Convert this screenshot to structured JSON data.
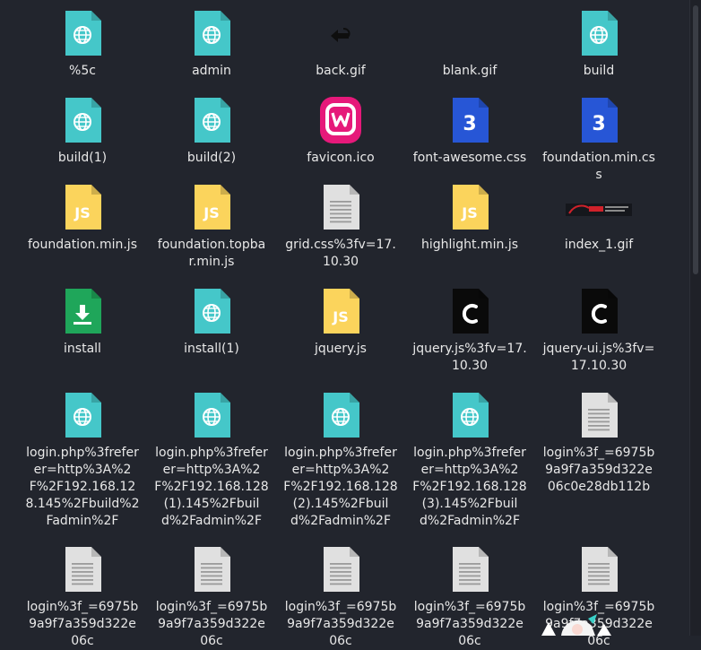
{
  "files": [
    {
      "name": "%5c",
      "icon": "web-icon"
    },
    {
      "name": "admin",
      "icon": "web-icon"
    },
    {
      "name": "back.gif",
      "icon": "back-arrow-icon"
    },
    {
      "name": "blank.gif",
      "icon": "blank-icon"
    },
    {
      "name": "build",
      "icon": "web-icon"
    },
    {
      "name": "build(1)",
      "icon": "web-icon"
    },
    {
      "name": "build(2)",
      "icon": "web-icon"
    },
    {
      "name": "favicon.ico",
      "icon": "wamp-logo-icon"
    },
    {
      "name": "font-awesome.css",
      "icon": "css-icon"
    },
    {
      "name": "foundation.min.css",
      "icon": "css-icon"
    },
    {
      "name": "foundation.min.js",
      "icon": "js-icon"
    },
    {
      "name": "foundation.topbar.min.js",
      "icon": "js-icon"
    },
    {
      "name": "grid.css%3fv=17.10.30",
      "icon": "text-file-icon"
    },
    {
      "name": "highlight.min.js",
      "icon": "js-icon"
    },
    {
      "name": "index_1.gif",
      "icon": "banner-image-icon"
    },
    {
      "name": "install",
      "icon": "installer-icon"
    },
    {
      "name": "install(1)",
      "icon": "web-icon"
    },
    {
      "name": "jquery.js",
      "icon": "js-icon"
    },
    {
      "name": "jquery.js%3fv=17.10.30",
      "icon": "c-file-icon"
    },
    {
      "name": "jquery-ui.js%3fv=17.10.30",
      "icon": "c-file-icon"
    },
    {
      "name": "login.php%3freferer=http%3A%2F%2F192.168.128.145%2Fbuild%2Fadmin%2F",
      "icon": "web-icon"
    },
    {
      "name": "login.php%3freferer=http%3A%2F%2F192.168.128(1).145%2Fbuild%2Fadmin%2F",
      "icon": "web-icon"
    },
    {
      "name": "login.php%3freferer=http%3A%2F%2F192.168.128(2).145%2Fbuild%2Fadmin%2F",
      "icon": "web-icon"
    },
    {
      "name": "login.php%3freferer=http%3A%2F%2F192.168.128(3).145%2Fbuild%2Fadmin%2F",
      "icon": "web-icon"
    },
    {
      "name": "login%3f_=6975b9a9f7a359d322e06c0e28db112b",
      "icon": "text-file-icon"
    },
    {
      "name": "login%3f_=6975b9a9f7a359d322e06c",
      "icon": "text-file-icon"
    },
    {
      "name": "login%3f_=6975b9a9f7a359d322e06c",
      "icon": "text-file-icon"
    },
    {
      "name": "login%3f_=6975b9a9f7a359d322e06c",
      "icon": "text-file-icon"
    },
    {
      "name": "login%3f_=6975b9a9f7a359d322e06c",
      "icon": "text-file-icon"
    },
    {
      "name": "login%3f_=6975b9a9f7a359d322e06c",
      "icon": "text-file-icon"
    }
  ],
  "colors": {
    "web": "#45c7c9",
    "css": "#2756d6",
    "js": "#fbd45c",
    "text": "#e0e0e0",
    "installer": "#1fa65a",
    "c_file": "#0a0a0a",
    "wamp": "#e6197a",
    "background": "#22252d"
  }
}
